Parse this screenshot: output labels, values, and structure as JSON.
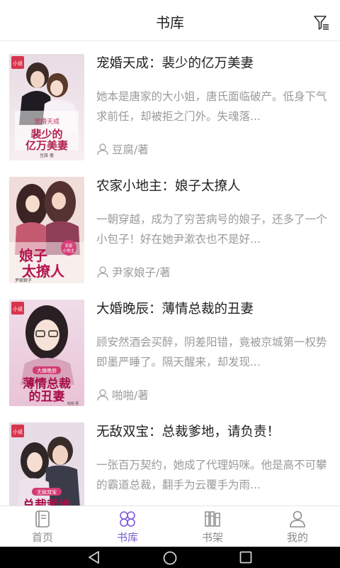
{
  "header": {
    "title": "书库",
    "filter_icon": "filter-icon"
  },
  "books": [
    {
      "title": "宠婚天成：裴少的亿万美妻",
      "desc": "她本是唐家的大小姐，唐氏面临破产。低身下气求前任，却被拒之门外。失魂落...",
      "author": "豆腐",
      "author_suffix": "/著",
      "cover_text": "裴少的亿万美妻",
      "cover_badge": "宠婚天成",
      "cover_author": "豆腐 著"
    },
    {
      "title": "农家小地主：娘子太撩人",
      "desc": "一朝穿越，成为了穷苦病号的娘子，还多了一个小包子！好在她尹漱衣也不是好...",
      "author": "尹家娘子",
      "author_suffix": "/著",
      "cover_text": "娘子太撩人",
      "cover_badge": "农家小地主",
      "cover_author": "尹家娘子"
    },
    {
      "title": "大婚晚辰：薄情总裁的丑妻",
      "desc": "顾安然酒会买醉，阴差阳错，竟被京城第一权势即墨严睡了。隔天醒来，却发现...",
      "author": "啪啪",
      "author_suffix": "/著",
      "cover_text": "薄情总裁的丑妻",
      "cover_badge": "大婚晚辰",
      "cover_author": "啪啪 著"
    },
    {
      "title": "无敌双宝：总裁爹地，请负责！",
      "desc": "一张百万契约，她成了代理妈咪。他是高不可攀的霸道总裁，翻手为云覆手为雨...",
      "author": "",
      "author_suffix": "",
      "cover_text": "总裁爹地",
      "cover_badge": "无敌双宝",
      "cover_author": ""
    }
  ],
  "cover_logo": "小说",
  "tabs": [
    {
      "label": "首页",
      "icon": "home-book-icon",
      "active": false
    },
    {
      "label": "书库",
      "icon": "library-icon",
      "active": true
    },
    {
      "label": "书架",
      "icon": "bookshelf-icon",
      "active": false
    },
    {
      "label": "我的",
      "icon": "profile-icon",
      "active": false
    }
  ],
  "nav": {
    "back": "back-icon",
    "home": "home-icon",
    "recents": "recents-icon"
  },
  "colors": {
    "accent": "#7b5cd6",
    "muted": "#9a9a9a",
    "cover_logo": "#d8344d"
  }
}
